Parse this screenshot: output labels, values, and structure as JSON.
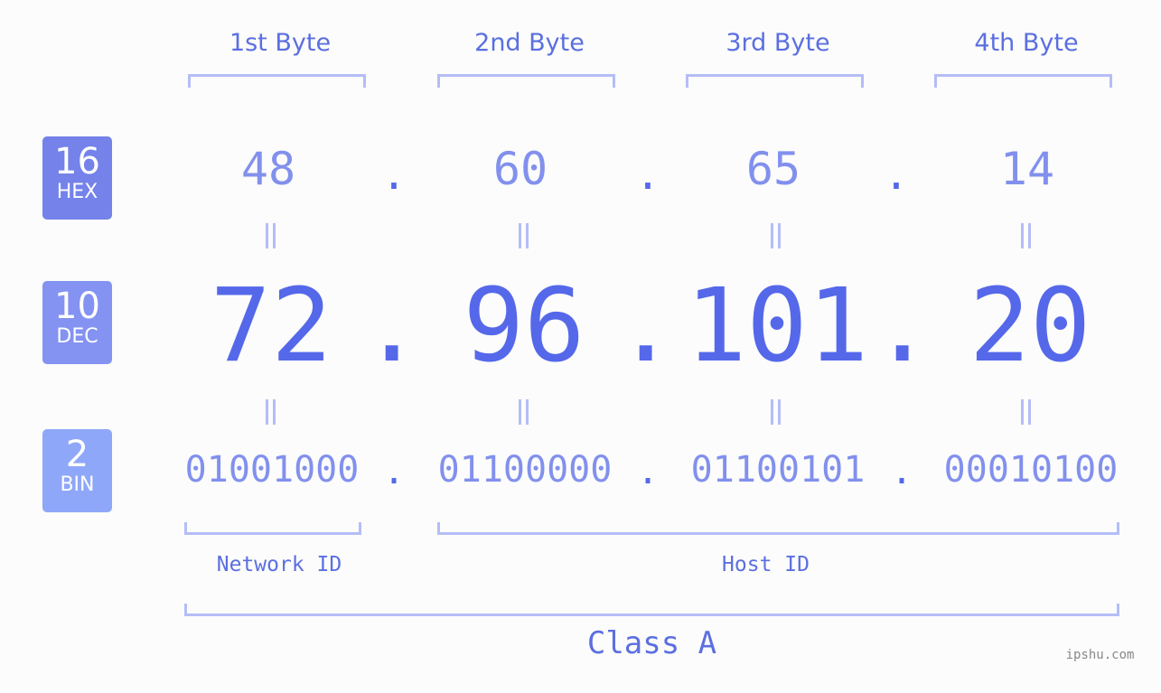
{
  "bytes": {
    "labels": [
      "1st Byte",
      "2nd Byte",
      "3rd Byte",
      "4th Byte"
    ]
  },
  "bases": {
    "hex": {
      "num": "16",
      "label": "HEX",
      "color": "#7482ea"
    },
    "dec": {
      "num": "10",
      "label": "DEC",
      "color": "#8492f2"
    },
    "bin": {
      "num": "2",
      "label": "BIN",
      "color": "#8fa7f8"
    }
  },
  "ip": {
    "hex": [
      "48",
      "60",
      "65",
      "14"
    ],
    "dec": [
      "72",
      "96",
      "101",
      "20"
    ],
    "bin": [
      "01001000",
      "01100000",
      "01100101",
      "00010100"
    ],
    "separator": "."
  },
  "sections": {
    "network_id": "Network ID",
    "host_id": "Host ID",
    "class": "Class A"
  },
  "watermark": "ipshu.com"
}
